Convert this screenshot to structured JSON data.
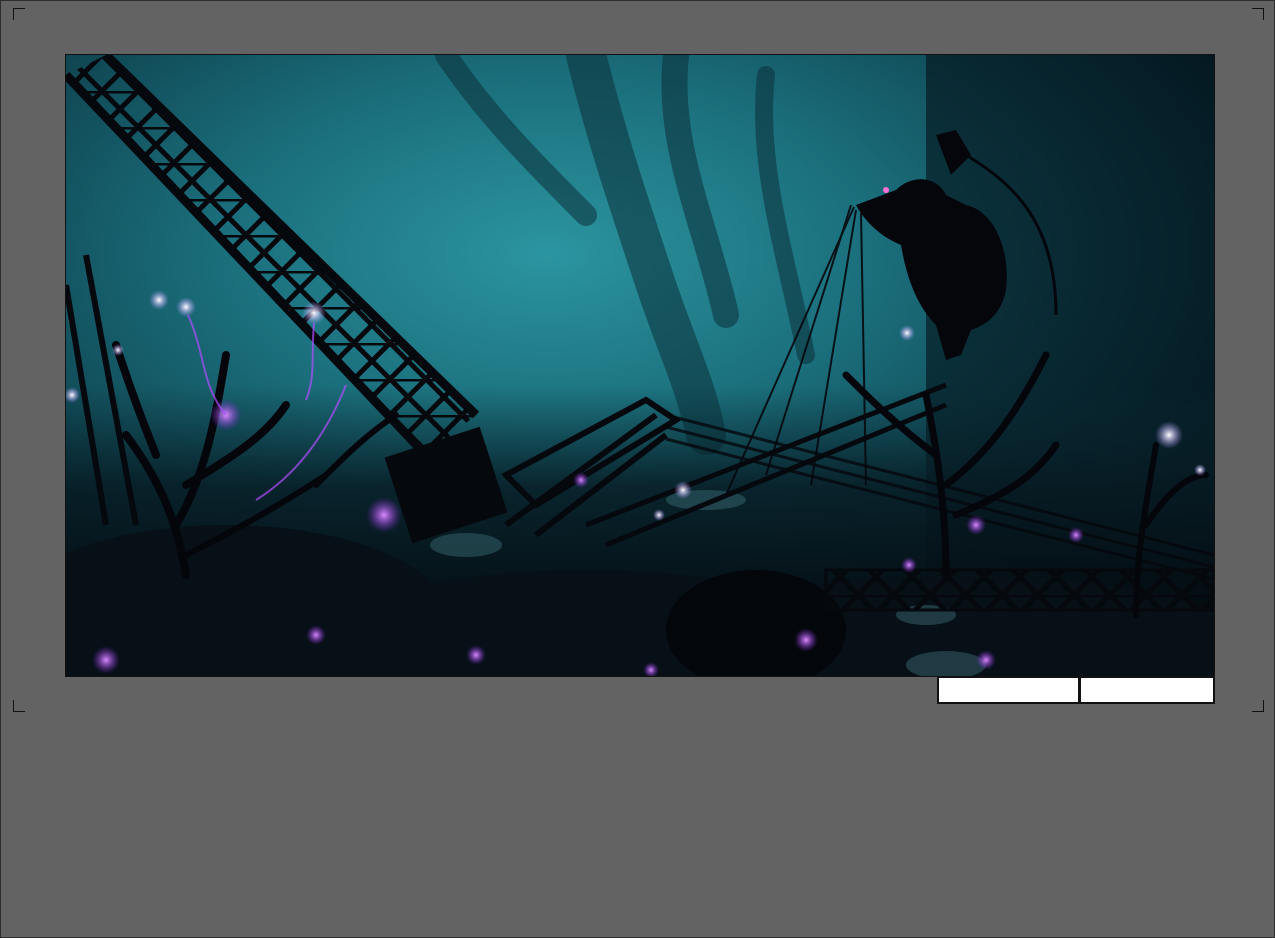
{
  "viewer": {
    "image_alt": "",
    "controls": [
      {
        "label": ""
      },
      {
        "label": ""
      }
    ]
  },
  "colors": {
    "page_background": "#636363",
    "scene_teal": "#1e7f8d",
    "scene_dark": "#04060d",
    "glow_violet": "#b04cff",
    "glow_white": "#f3f0ff",
    "control_fill": "#ffffff"
  }
}
